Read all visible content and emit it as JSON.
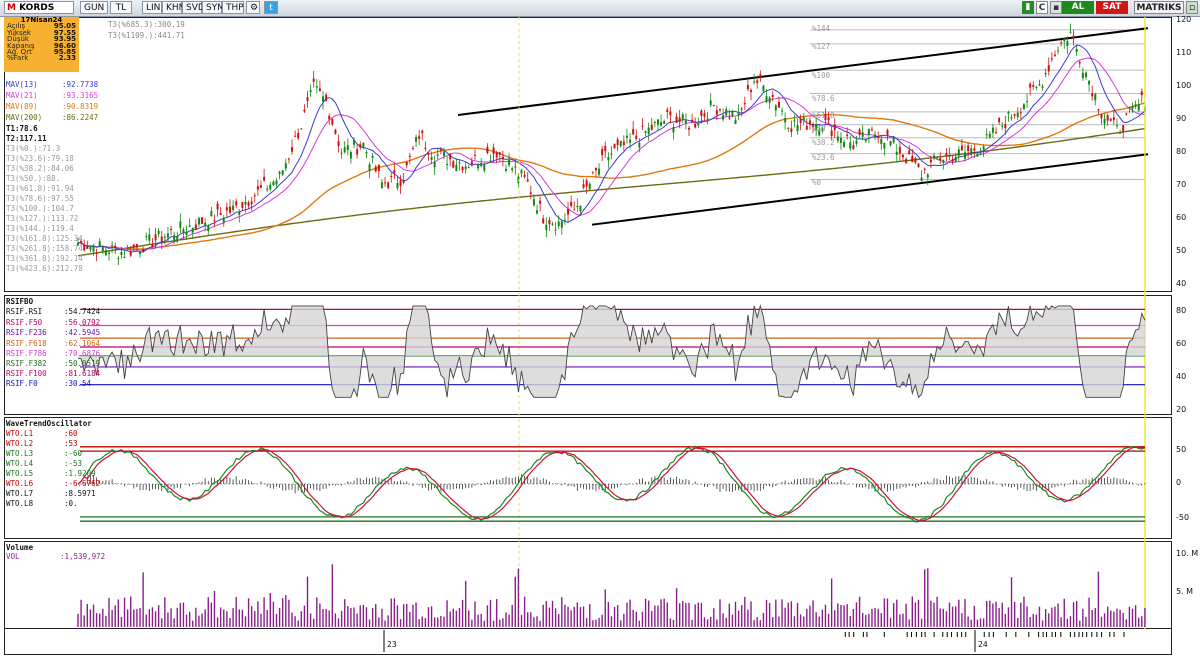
{
  "toolbar": {
    "logo": "M",
    "symbol": "KORDS",
    "buttons": [
      "GUN",
      "TL",
      "LIN",
      "KHN",
      "SVD",
      "SYM",
      "THP"
    ],
    "al_label": "AL",
    "sat_label": "SAT",
    "brand": "MATRIKS",
    "c_label": "C"
  },
  "ohlc": {
    "date": "17Nisan24",
    "rows": [
      {
        "label": "Açılış",
        "value": "95.05"
      },
      {
        "label": "Yüksek",
        "value": "97.55"
      },
      {
        "label": "Düşük",
        "value": "93.95"
      },
      {
        "label": "Kapanış",
        "value": "96.60"
      },
      {
        "label": "Ağ. Ort",
        "value": "95.85"
      },
      {
        "label": "%Fark",
        "value": "2.33"
      }
    ]
  },
  "price_panel": {
    "top_labels": [
      "T3(%685.3):300.19",
      "T3(%1109.):441.71"
    ],
    "indicators": [
      {
        "name": "MAV(13)",
        "value": ":92.7738",
        "color": "#3b3bd8"
      },
      {
        "name": "MAV(21)",
        "value": ":93.3165",
        "color": "#d83bd8"
      },
      {
        "name": "MAV(89)",
        "value": ":90.8319",
        "color": "#e07a10"
      },
      {
        "name": "MAV(200)",
        "value": ":86.2247",
        "color": "#6d6a10"
      }
    ],
    "t_labels": [
      "T1:78.6",
      "T2:117.11"
    ],
    "fib_labels": [
      "T3(%0.):71.3",
      "T3(%23.6):79.18",
      "T3(%38.2):84.06",
      "T3(%50.):88.",
      "T3(%61.8):91.94",
      "T3(%78.6):97.55",
      "T3(%100.):104.7",
      "T3(%127.):113.72",
      "T3(%144.):119.4",
      "T3(%161.8):125.34",
      "T3(%261.8):158.74",
      "T3(%361.8):192.14",
      "T3(%423.6):212.78"
    ],
    "fib_levels": [
      "%144",
      "%127",
      "%100",
      "%78.6",
      "%61.8",
      "%50",
      "%38.2",
      "%23.6",
      "%0"
    ],
    "axis": [
      "120",
      "110",
      "100",
      "90",
      "80",
      "70",
      "60",
      "50",
      "40"
    ]
  },
  "rsi_panel": {
    "title": "RSIFBO",
    "rows": [
      {
        "name": "RSIF.RSI",
        "value": ":54.7424",
        "color": "#111111"
      },
      {
        "name": "RSIF.F50",
        "value": ":56.0792",
        "color": "#c00060"
      },
      {
        "name": "RSIF.F236",
        "value": ":42.5945",
        "color": "#6a10c0"
      },
      {
        "name": "RSIF.F618",
        "value": ":62.1064",
        "color": "#d06010"
      },
      {
        "name": "RSIF.F786",
        "value": ":70.6876",
        "color": "#d040d0"
      },
      {
        "name": "RSIF.F382",
        "value": ":50.0519",
        "color": "#207020"
      },
      {
        "name": "RSIF.F100",
        "value": ":81.6184",
        "color": "#c00060"
      },
      {
        "name": "RSIF.F0",
        "value": ":30.54",
        "color": "#1010c0"
      }
    ],
    "axis": [
      "80",
      "60",
      "40",
      "20"
    ]
  },
  "wto_panel": {
    "title": "WaveTrendOscillator",
    "rows": [
      {
        "name": "WTO.L1",
        "value": ":60",
        "color": "#c00000"
      },
      {
        "name": "WTO.L2",
        "value": ":53",
        "color": "#c00000"
      },
      {
        "name": "WTO.L3",
        "value": ":-60",
        "color": "#207020"
      },
      {
        "name": "WTO.L4",
        "value": ":-53",
        "color": "#207020"
      },
      {
        "name": "WTO.L5",
        "value": ":1.9209",
        "color": "#207020"
      },
      {
        "name": "WTO.L6",
        "value": ":-6.6762",
        "color": "#c00000"
      },
      {
        "name": "WTO.L7",
        "value": ":8.5971",
        "color": "#111111"
      },
      {
        "name": "WTO.L8",
        "value": ":0.",
        "color": "#111111"
      }
    ],
    "axis": [
      "50",
      "0",
      "-50"
    ]
  },
  "volume_panel": {
    "title": "Volume",
    "name": "VOL",
    "value": ":1,539,972",
    "axis": [
      "10. M",
      "5. M"
    ]
  },
  "date_axis": [
    "23",
    "24"
  ],
  "colors": {
    "candle_up": "#118811",
    "candle_down": "#cc1111",
    "volume": "#8a1f8a",
    "cursor": "#e8e820"
  }
}
